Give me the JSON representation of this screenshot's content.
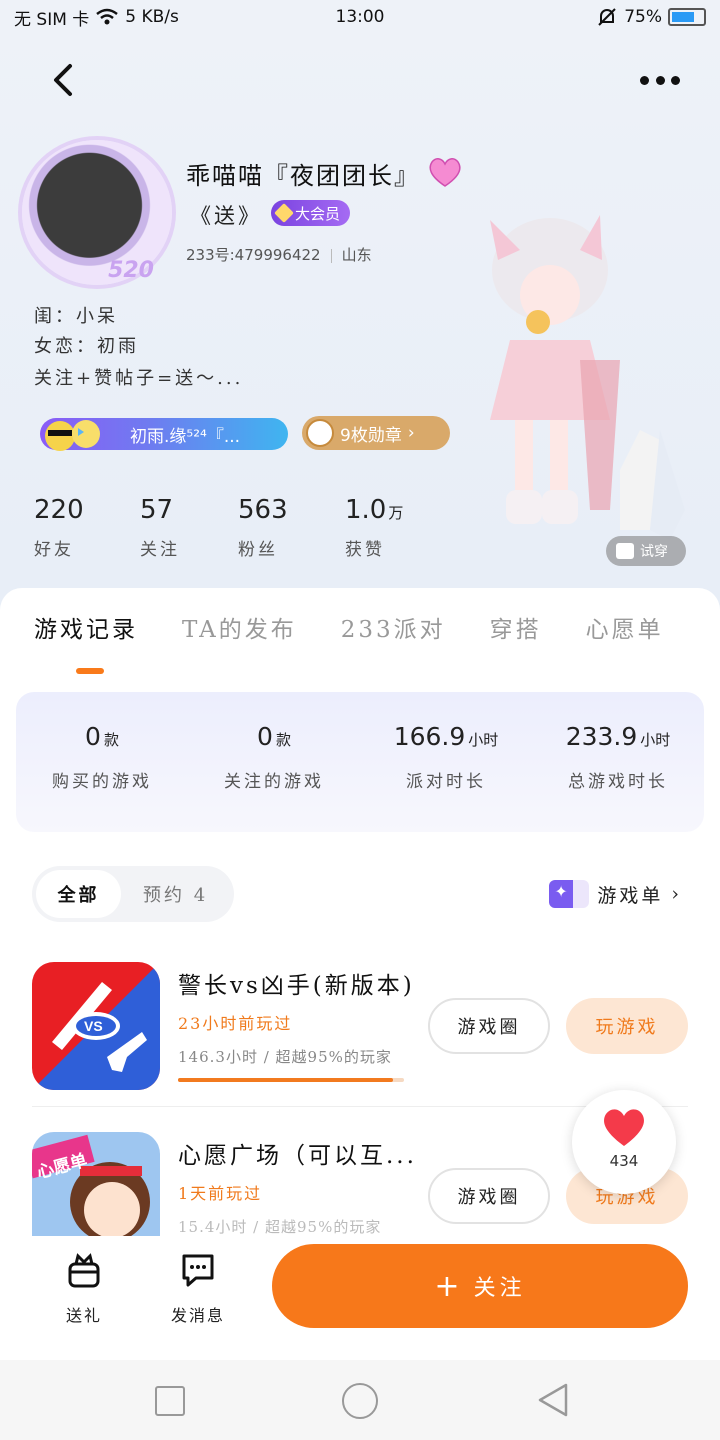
{
  "status_bar": {
    "carrier": "无 SIM 卡",
    "speed": "5 KB/s",
    "time": "13:00",
    "battery": "75%",
    "battery_level": 0.75
  },
  "profile": {
    "avatar_badge": "520",
    "nickname": "乖喵喵『夜团团长』",
    "subname": "《送》",
    "vip_label": "大会员",
    "uid": "233号:479996422",
    "region": "山东",
    "bio": [
      "闺：小呆",
      "女恋：初雨",
      "关注+赞帖子=送～..."
    ],
    "couple_tag": "初雨.缘⁵²⁴『...",
    "medals": "9枚勋章",
    "stats": [
      {
        "num": "220",
        "unit": "",
        "label": "好友"
      },
      {
        "num": "57",
        "unit": "",
        "label": "关注"
      },
      {
        "num": "563",
        "unit": "",
        "label": "粉丝"
      },
      {
        "num": "1.0",
        "unit": "万",
        "label": "获赞"
      }
    ],
    "try_on": "试穿"
  },
  "tabs": [
    "游戏记录",
    "TA的发布",
    "233派对",
    "穿搭",
    "心愿单"
  ],
  "summary": [
    {
      "value": "0",
      "unit": "款",
      "label": "购买的游戏"
    },
    {
      "value": "0",
      "unit": "款",
      "label": "关注的游戏"
    },
    {
      "value": "166.9",
      "unit": "小时",
      "label": "派对时长"
    },
    {
      "value": "233.9",
      "unit": "小时",
      "label": "总游戏时长"
    }
  ],
  "filter": {
    "all": "全部",
    "reserved": "预约 4"
  },
  "game_list_label": "游戏单",
  "games": [
    {
      "title": "警长vs凶手(新版本)",
      "played": "23小时前玩过",
      "hours": "146.3小时 / 超越95%的玩家",
      "progress": 0.95,
      "circle": "游戏圈",
      "play": "玩游戏"
    },
    {
      "title": "心愿广场（可以互...",
      "played": "1天前玩过",
      "hours": "15.4小时 / 超越95%的玩家",
      "circle": "游戏圈",
      "play": "玩游戏",
      "icon_text": "心愿单"
    }
  ],
  "likes_count": "434",
  "actions": {
    "gift": "送礼",
    "message": "发消息",
    "follow": "关注"
  },
  "colors": {
    "accent": "#f7781a",
    "vip": "#7a43e0",
    "medal": "#d9a96a"
  }
}
